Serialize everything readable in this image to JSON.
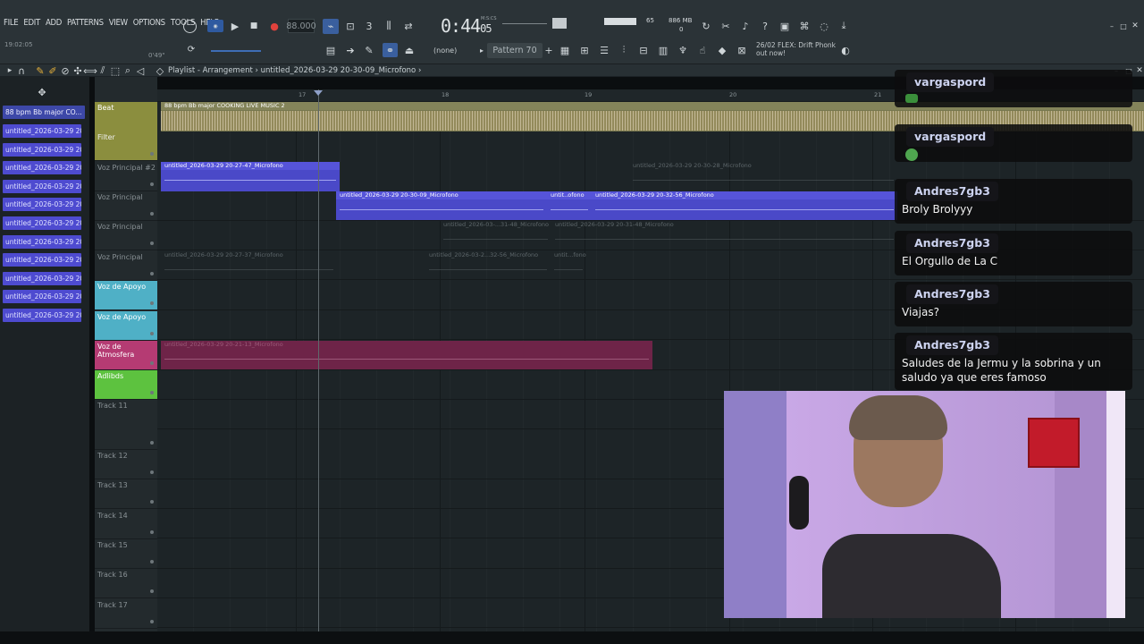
{
  "menu": [
    "FILE",
    "EDIT",
    "ADD",
    "PATTERNS",
    "VIEW",
    "OPTIONS",
    "TOOLS",
    "HELP"
  ],
  "transport": {
    "tempo": "88.000",
    "time_main": "0:44",
    "time_sub": "05",
    "time_label": "M:S:CS",
    "cpu": "65",
    "ram": "886 MB",
    "ram_sub": "0",
    "clock_left": "19:02:05",
    "clock_right": "0'49\""
  },
  "toolbar2": {
    "snap": "(none)",
    "pattern": "Pattern 70",
    "hint_line1": "26/02  FLEX: Drift Phonk",
    "hint_line2": "out now!"
  },
  "playlist": {
    "title": "Playlist - Arrangement",
    "breadcrumb": "untitled_2026-03-29 20-30-09_Microfono",
    "browser_top": "88 bpm Bb major CO...",
    "browser_items": [
      "untitled_2026-03-29 20-",
      "untitled_2026-03-29 20-",
      "untitled_2026-03-29 20-",
      "untitled_2026-03-29 20-",
      "untitled_2026-03-29 20-",
      "untitled_2026-03-29 20-",
      "untitled_2026-03-29 20-",
      "untitled_2026-03-29 20-",
      "untitled_2026-03-29 20-",
      "untitled_2026-03-29 20-",
      "untitled_2026-03-29 20-"
    ],
    "ruler": [
      "17",
      "18",
      "19",
      "20",
      "21"
    ],
    "tracks": [
      {
        "name": "Beat",
        "color": "#8b8e3e",
        "sub": "Filter"
      },
      {
        "name": "Voz Principal #2",
        "color": ""
      },
      {
        "name": "Voz Principal",
        "color": ""
      },
      {
        "name": "Voz Principal",
        "color": ""
      },
      {
        "name": "Voz Principal",
        "color": ""
      },
      {
        "name": "Voz de Apoyo",
        "color": "#4fb0c6"
      },
      {
        "name": "Voz de Apoyo",
        "color": "#4fb0c6"
      },
      {
        "name": "Voz de Atmosfera",
        "color": "#b53b73"
      },
      {
        "name": "Adlibds",
        "color": "#5dc23f"
      },
      {
        "name": "Track 11",
        "color": ""
      },
      {
        "name": "Track 12",
        "color": ""
      },
      {
        "name": "Track 13",
        "color": ""
      },
      {
        "name": "Track 14",
        "color": ""
      },
      {
        "name": "Track 15",
        "color": ""
      },
      {
        "name": "Track 16",
        "color": ""
      },
      {
        "name": "Track 17",
        "color": ""
      }
    ],
    "beat_clip": "88 bpm Bb major COOKING LIVE MUSIC 2",
    "clips": {
      "c1": "untitled_2026-03-29 20-27-47_Microfono",
      "c2": "untitled_2026-03-29 20-30-28_Microfono",
      "c3": "untitled_2026-03-29 20-30-09_Microfono",
      "c4": "untit..ofono",
      "c5": "untitled_2026-03-29 20-32-56_Microfono",
      "c6": "untitled_2026-03-...31-48_Microfono",
      "c7": "untitled_2026-03-29 20-31-48_Microfono",
      "c8": "untitled_2026-03-29 20-27-37_Microfono",
      "c9": "untitled_2026-03-2...32-56_Microfono",
      "c10": "untit...fono",
      "c11": "untitled_2026-03-29 20-21-13_Microfono"
    }
  },
  "chat": [
    {
      "user": "vargaspord",
      "text": ""
    },
    {
      "user": "vargaspord",
      "text": ""
    },
    {
      "user": "Andres7gb3",
      "text": "Broly Brolyyy"
    },
    {
      "user": "Andres7gb3",
      "text": "El Orgullo de La C"
    },
    {
      "user": "Andres7gb3",
      "text": "Viajas?"
    },
    {
      "user": "Andres7gb3",
      "text": "Saludes de la Jermu y la sobrina y un saludo ya que eres famoso"
    }
  ]
}
